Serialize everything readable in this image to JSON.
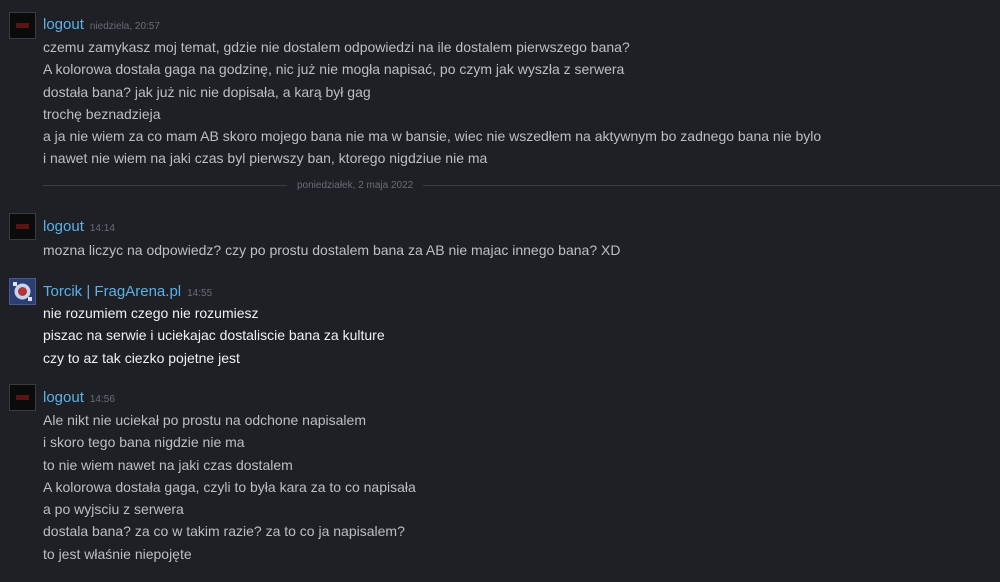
{
  "messages": [
    {
      "author": "logout",
      "timestamp": "niedziela, 20:57",
      "lines": [
        "czemu zamykasz moj temat, gdzie nie dostalem odpowiedzi na ile dostalem pierwszego bana?",
        "A kolorowa dostała gaga na godzinę, nic już nie mogła napisać, po czym jak wyszła z serwera",
        "dostała bana? jak już nic nie dopisała, a karą był gag",
        "trochę beznadzieja",
        "a ja nie wiem za co mam AB skoro mojego bana nie ma w bansie, wiec nie wszedłem na aktywnym bo zadnego bana nie bylo",
        "i nawet nie wiem na jaki czas byl pierwszy ban, ktorego nigdziue nie ma"
      ]
    },
    {
      "author": "logout",
      "timestamp": "14:14",
      "lines": [
        "mozna liczyc na odpowiedz? czy po prostu dostalem bana za AB nie majac innego bana? XD"
      ]
    },
    {
      "author": "Torcik | FragArena.pl",
      "timestamp": "14:55",
      "lines": [
        "nie rozumiem czego nie rozumiesz",
        "piszac na serwie i uciekajac dostaliscie bana za kulture",
        "czy to az tak ciezko pojetne jest"
      ]
    },
    {
      "author": "logout",
      "timestamp": "14:56",
      "lines": [
        "Ale nikt nie uciekał po prostu na odchone napisalem",
        "i skoro tego bana nigdzie nie ma",
        "to nie wiem nawet na jaki czas dostalem",
        "A kolorowa dostała gaga, czyli to była kara za to co napisała",
        "a po wyjsciu z serwera",
        "dostala bana? za co w takim razie? za to co ja napisalem?",
        "to jest właśnie niepojęte"
      ]
    }
  ],
  "date_divider": "poniedziałek, 2 maja 2022",
  "colors": {
    "background": "#1e2025",
    "author_name": "#5ab1e8",
    "body_text": "#bdbfc3",
    "highlight_text": "#f0f1f3",
    "timestamp": "#6a6d74"
  },
  "icons": {
    "avatar_logout": "avatar-icon",
    "avatar_torcik": "avatar-icon"
  }
}
